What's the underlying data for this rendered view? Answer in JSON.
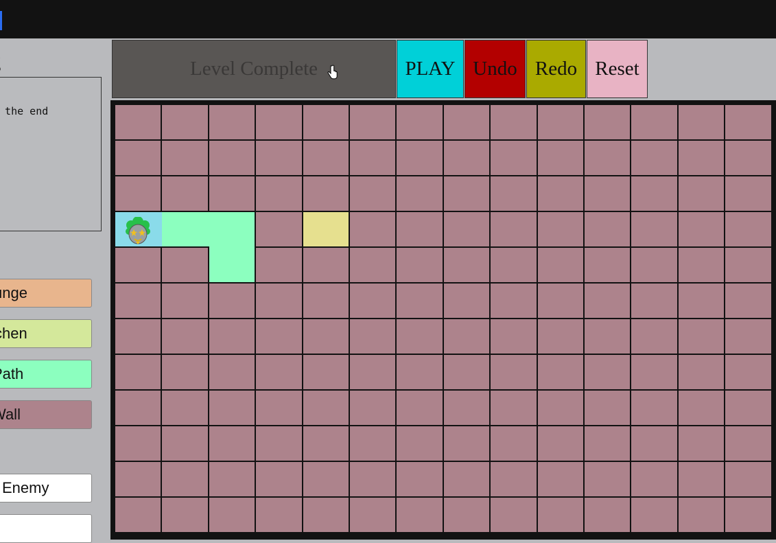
{
  "sidebar": {
    "level_heading": "g",
    "description": "o the end",
    "tiles_heading": "s",
    "tiles": [
      {
        "label": "unge",
        "color": "#e8b58d"
      },
      {
        "label": "chen",
        "color": "#d4e89b"
      },
      {
        "label": "Path",
        "color": "#8cffbf"
      },
      {
        "label": "Wall",
        "color": "#ad838c"
      }
    ],
    "units": [
      {
        "label": "Enemy",
        "color": "#ffffff"
      }
    ]
  },
  "toolbar": {
    "status_label": "Level Complete",
    "play_label": "PLAY",
    "undo_label": "Undo",
    "redo_label": "Redo",
    "reset_label": "Reset",
    "colors": {
      "status": "#595654",
      "play": "#00d0d8",
      "undo": "#b30000",
      "redo": "#aaaa00",
      "reset": "#e8b3c4"
    }
  },
  "board": {
    "rows": 12,
    "cols": 14,
    "default_tile": "wall",
    "tile_colors": {
      "wall": "#ad838c",
      "path": "#8cffbf",
      "start": "#8adbea",
      "kitchen": "#e6e08f"
    },
    "special_cells": [
      {
        "row": 3,
        "col": 0,
        "tile": "start"
      },
      {
        "row": 3,
        "col": 1,
        "tile": "path"
      },
      {
        "row": 3,
        "col": 2,
        "tile": "path"
      },
      {
        "row": 4,
        "col": 2,
        "tile": "path"
      },
      {
        "row": 3,
        "col": 4,
        "tile": "kitchen"
      }
    ],
    "player": {
      "row": 3,
      "col": 0,
      "icon": "clown-face-icon"
    }
  }
}
